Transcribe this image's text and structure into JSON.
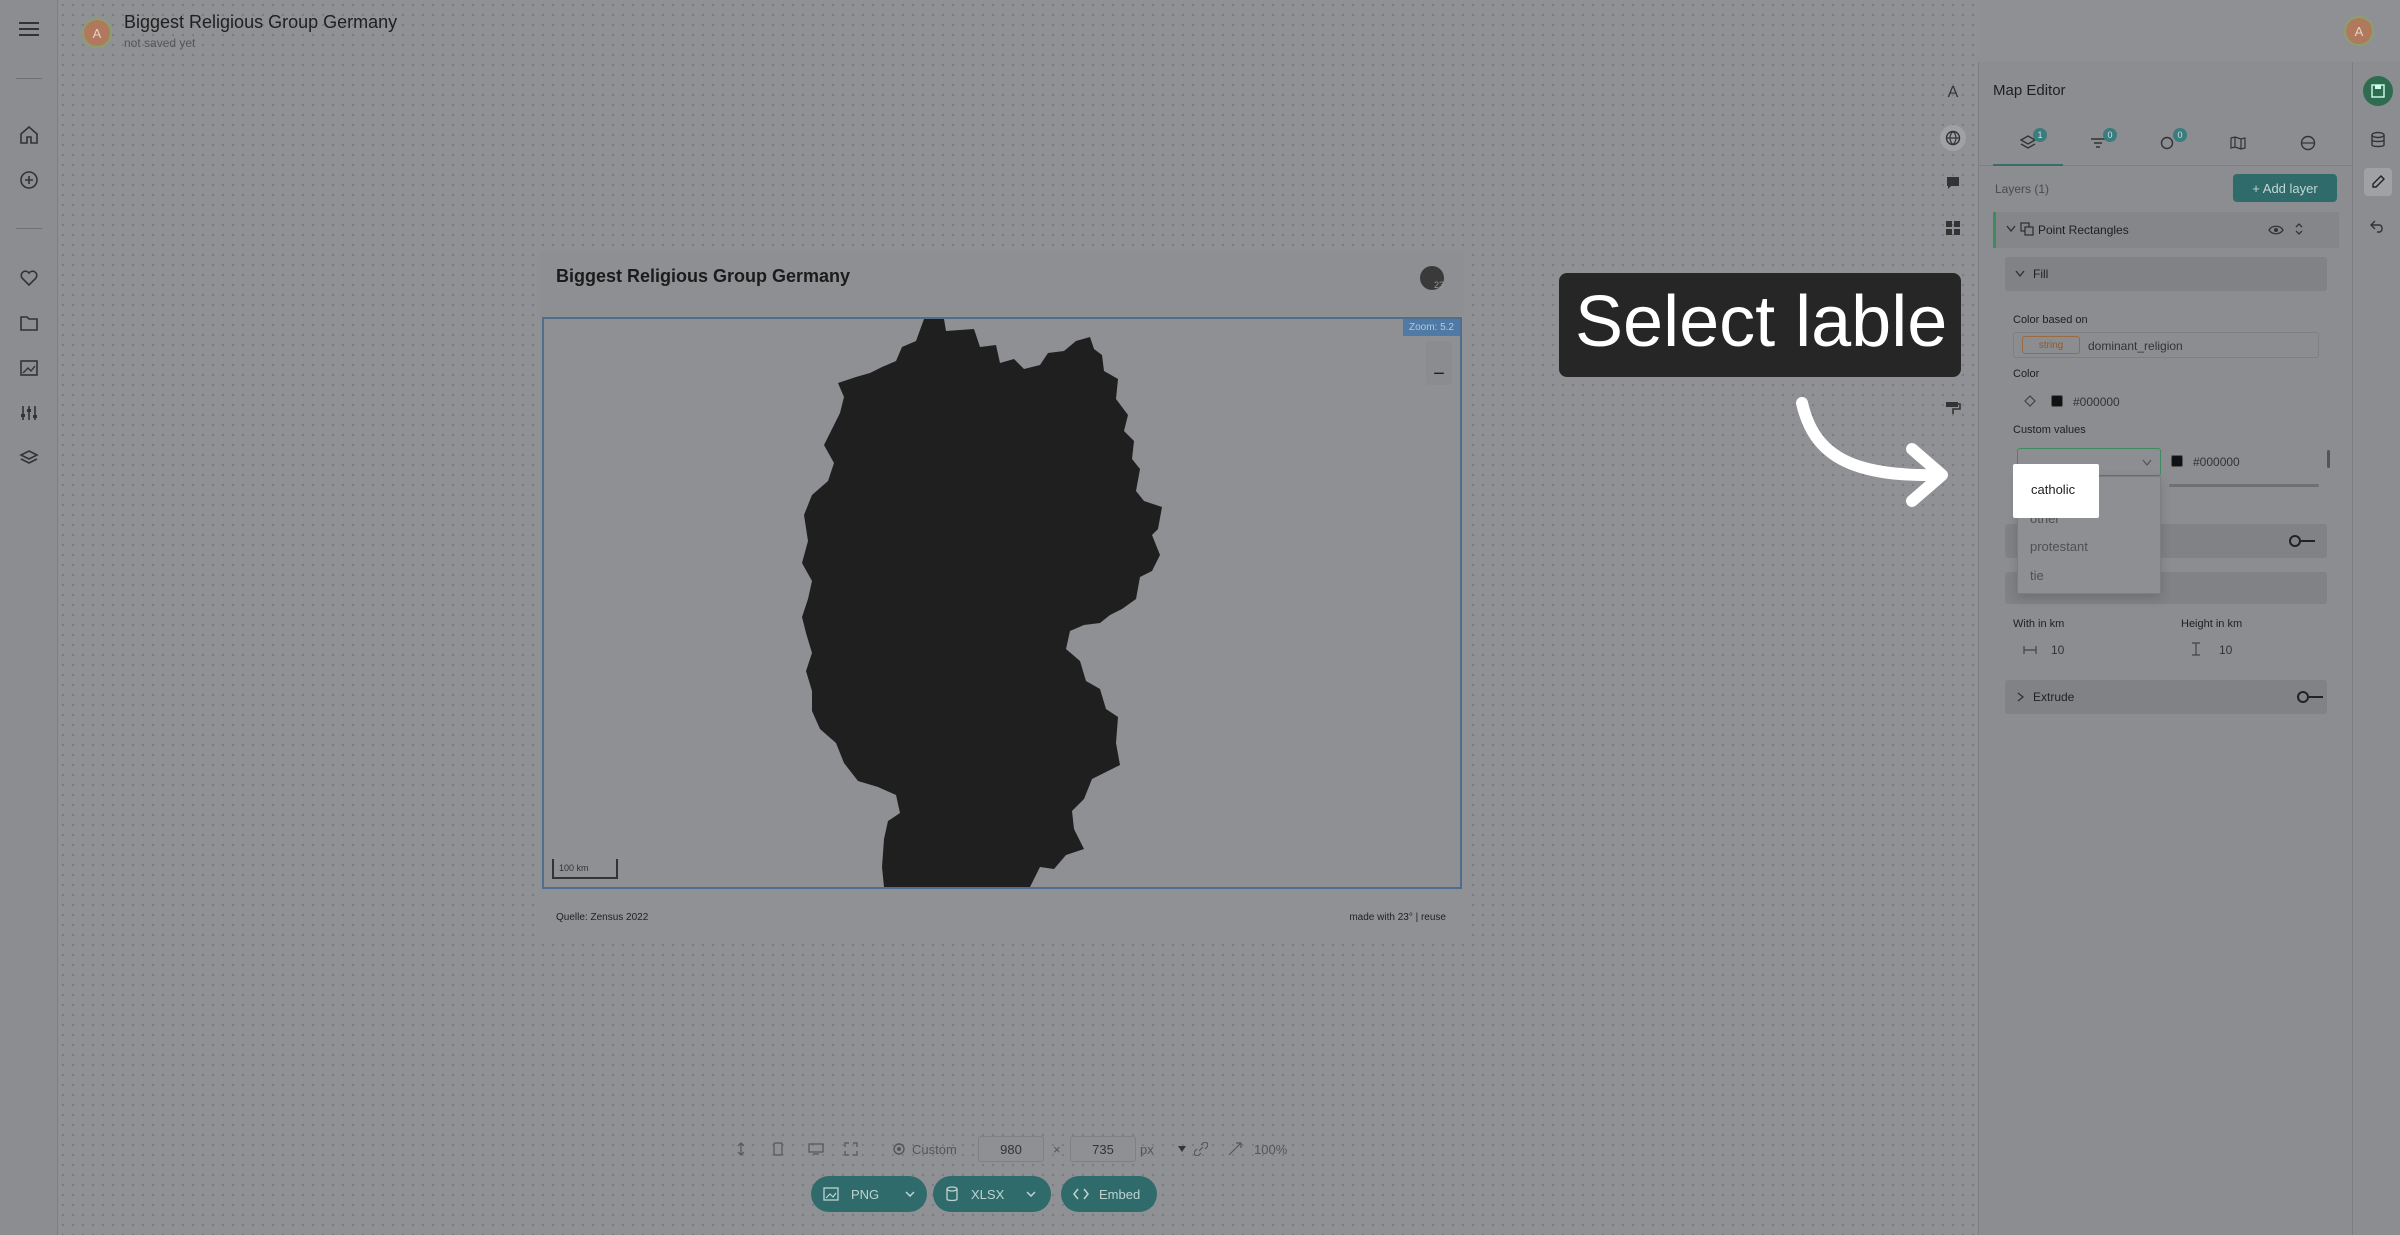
{
  "header": {
    "title": "Biggest Religious Group Germany",
    "subtitle": "not saved yet",
    "avatar_initial": "A",
    "user_initial": "A"
  },
  "card": {
    "title": "Biggest Religious Group Germany",
    "zoom_label": "Zoom: 5.2",
    "scale_label": "100 km",
    "source": "Quelle: Zensus 2022",
    "credit": "made with 23° | reuse",
    "logo_text": "23"
  },
  "tooltip": {
    "text": "Select lable"
  },
  "editor": {
    "title": "Map Editor",
    "tab_badges": [
      "1",
      "0",
      "0"
    ],
    "layers_label": "Layers (1)",
    "add_layer": "+ Add layer",
    "layer_name": "Point Rectangles",
    "fill_label": "Fill",
    "color_based_on": "Color based on",
    "type_chip": "string",
    "field": "dominant_religion",
    "color_label": "Color",
    "color_value": "#000000",
    "custom_values_label": "Custom values",
    "custom_color_value": "#000000",
    "dropdown_options": [
      "catholic",
      "other",
      "protestant",
      "tie"
    ],
    "width_label": "With in km",
    "width_value": "10",
    "height_label": "Height in km",
    "height_value": "10",
    "extrude_label": "Extrude"
  },
  "bottom": {
    "preset": "Custom",
    "width": "980",
    "times": "×",
    "height": "735",
    "unit": "px",
    "zoom": "100%",
    "png": "PNG",
    "xlsx": "XLSX",
    "embed": "Embed"
  },
  "colors": {
    "accent": "#2f6b6b",
    "map_fill": "#1f1f1f",
    "tooltip_bg": "#262626"
  }
}
